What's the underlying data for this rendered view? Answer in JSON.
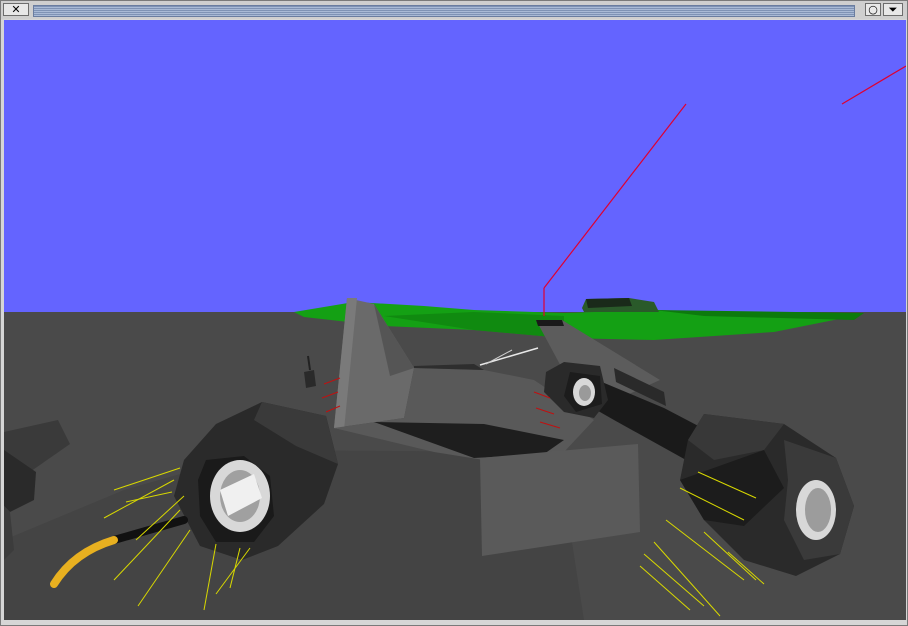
{
  "window": {
    "close_glyph": "✕",
    "iconify_glyph": "○",
    "menu_glyph": "⏷"
  },
  "scene": {
    "colors": {
      "sky": "#6464ff",
      "ground": "#4a4a4a",
      "hills": "#14a014",
      "car_body": "#5a5a5a",
      "tire": "#2a2a2a",
      "hub": "#d8d8d8",
      "sparks": "#d8d800",
      "laser": "#e00030",
      "antenna_tip": "#e8b020"
    }
  }
}
